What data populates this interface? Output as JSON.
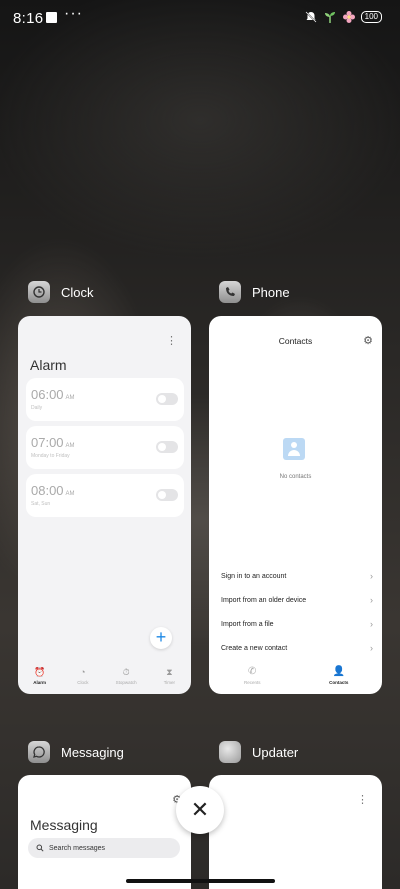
{
  "status_bar": {
    "time": "8:16",
    "overflow": "···",
    "icons": [
      "notification-off-icon",
      "sprout-icon",
      "flower-icon"
    ],
    "battery": "100"
  },
  "cards": {
    "clock": {
      "app_name": "Clock",
      "menu_glyph": "⋮",
      "screen_title": "Alarm",
      "alarms": [
        {
          "time": "06:00",
          "ampm": "AM",
          "sub": "Daily",
          "enabled": false
        },
        {
          "time": "07:00",
          "ampm": "AM",
          "sub": "Monday to Friday",
          "enabled": false
        },
        {
          "time": "08:00",
          "ampm": "AM",
          "sub": "Sat, Sun",
          "enabled": false
        }
      ],
      "add_glyph": "+",
      "tabs": [
        {
          "label": "Alarm",
          "glyph": "⏰"
        },
        {
          "label": "Clock",
          "glyph": "◔"
        },
        {
          "label": "Stopwatch",
          "glyph": "⏱"
        },
        {
          "label": "Timer",
          "glyph": "⧗"
        }
      ]
    },
    "phone": {
      "app_name": "Phone",
      "header": "Contacts",
      "gear_glyph": "⚙",
      "empty_text": "No contacts",
      "options": [
        "Sign in to an account",
        "Import from an older device",
        "Import from a file",
        "Create a new contact"
      ],
      "chevron": "›",
      "tabs": [
        {
          "label": "Recents",
          "glyph": "✆"
        },
        {
          "label": "Contacts",
          "glyph": "👤"
        }
      ]
    },
    "messaging": {
      "app_name": "Messaging",
      "gear_glyph": "⚙",
      "title": "Messaging",
      "search_placeholder": "Search messages"
    },
    "updater": {
      "app_name": "Updater",
      "menu_glyph": "⋮"
    }
  },
  "close_all_glyph": "✕"
}
